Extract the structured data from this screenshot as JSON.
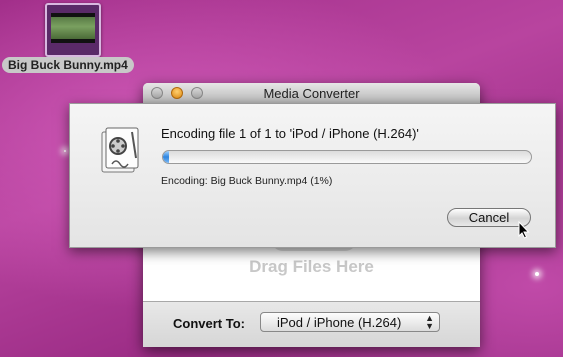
{
  "desktop": {
    "file_label": "Big Buck Bunny.mp4"
  },
  "window": {
    "title": "Media Converter",
    "drop_text": "Drag Files Here",
    "convert_to_label": "Convert To:",
    "convert_to_value": "iPod / iPhone (H.264)"
  },
  "sheet": {
    "status_text": "Encoding file 1 of 1 to 'iPod / iPhone (H.264)'",
    "progress_percent": 1,
    "detail_text": "Encoding: Big Buck Bunny.mp4 (1%)",
    "cancel_label": "Cancel"
  },
  "colors": {
    "desktop": "#b03d96",
    "progress": "#2f86e0"
  }
}
